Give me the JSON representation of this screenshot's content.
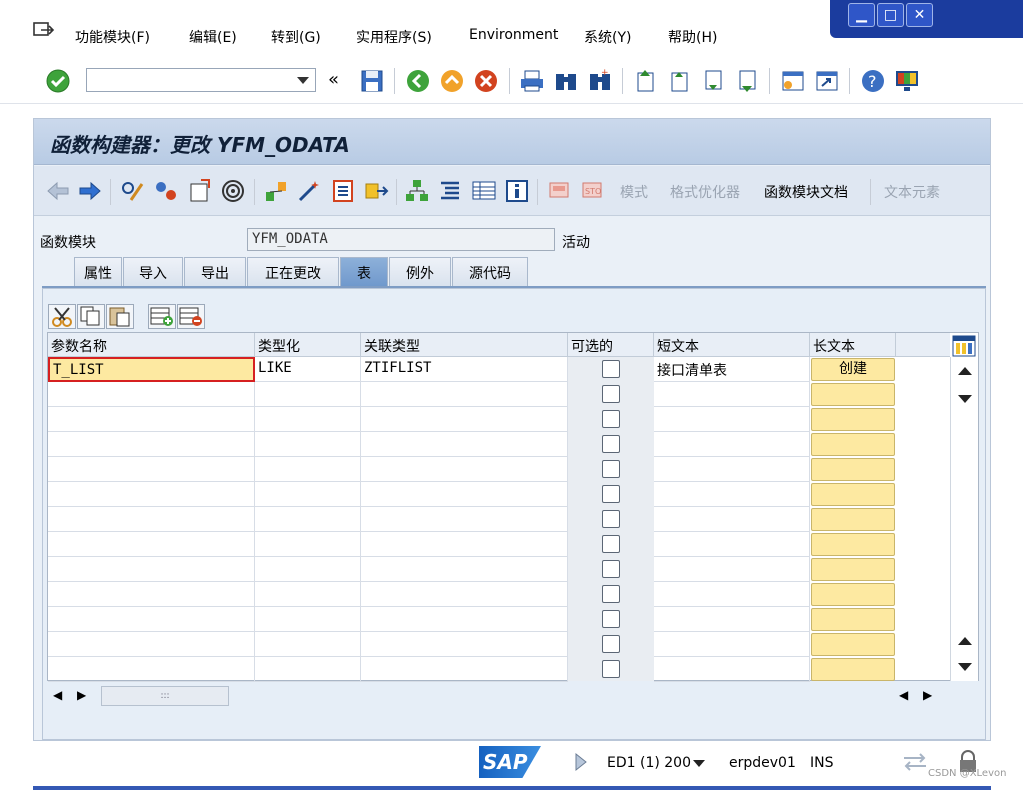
{
  "menubar": {
    "items": [
      "功能模块(F)",
      "编辑(E)",
      "转到(G)",
      "实用程序(S)",
      "Environment",
      "系统(Y)",
      "帮助(H)"
    ]
  },
  "window_controls": [
    "minimize",
    "maximize",
    "close"
  ],
  "std_toolbar": {
    "command_field": {
      "value": "",
      "placeholder": ""
    }
  },
  "title": "函数构建器：更改 YFM_ODATA",
  "app_toolbar": {
    "text_buttons": [
      {
        "label": "模式",
        "enabled": false
      },
      {
        "label": "格式优化器",
        "enabled": false
      },
      {
        "label": "函数模块文档",
        "enabled": true
      },
      {
        "label": "文本元素",
        "enabled": false
      }
    ]
  },
  "function_module": {
    "label": "函数模块",
    "value": "YFM_ODATA",
    "status": "活动"
  },
  "tabs": [
    {
      "label": "属性",
      "active": false
    },
    {
      "label": "导入",
      "active": false
    },
    {
      "label": "导出",
      "active": false
    },
    {
      "label": "正在更改",
      "active": false
    },
    {
      "label": "表",
      "active": true
    },
    {
      "label": "例外",
      "active": false
    },
    {
      "label": "源代码",
      "active": false
    }
  ],
  "grid": {
    "columns": [
      "参数名称",
      "类型化",
      "关联类型",
      "可选的",
      "短文本",
      "长文本"
    ],
    "rows": [
      {
        "param": "T_LIST",
        "typing": "LIKE",
        "assoc_type": "ZTIFLIST",
        "optional": false,
        "short_text": "接口清单表",
        "long_text": "创建"
      },
      {
        "param": "",
        "typing": "",
        "assoc_type": "",
        "optional": false,
        "short_text": "",
        "long_text": ""
      },
      {
        "param": "",
        "typing": "",
        "assoc_type": "",
        "optional": false,
        "short_text": "",
        "long_text": ""
      },
      {
        "param": "",
        "typing": "",
        "assoc_type": "",
        "optional": false,
        "short_text": "",
        "long_text": ""
      },
      {
        "param": "",
        "typing": "",
        "assoc_type": "",
        "optional": false,
        "short_text": "",
        "long_text": ""
      },
      {
        "param": "",
        "typing": "",
        "assoc_type": "",
        "optional": false,
        "short_text": "",
        "long_text": ""
      },
      {
        "param": "",
        "typing": "",
        "assoc_type": "",
        "optional": false,
        "short_text": "",
        "long_text": ""
      },
      {
        "param": "",
        "typing": "",
        "assoc_type": "",
        "optional": false,
        "short_text": "",
        "long_text": ""
      },
      {
        "param": "",
        "typing": "",
        "assoc_type": "",
        "optional": false,
        "short_text": "",
        "long_text": ""
      },
      {
        "param": "",
        "typing": "",
        "assoc_type": "",
        "optional": false,
        "short_text": "",
        "long_text": ""
      },
      {
        "param": "",
        "typing": "",
        "assoc_type": "",
        "optional": false,
        "short_text": "",
        "long_text": ""
      },
      {
        "param": "",
        "typing": "",
        "assoc_type": "",
        "optional": false,
        "short_text": "",
        "long_text": ""
      },
      {
        "param": "",
        "typing": "",
        "assoc_type": "",
        "optional": false,
        "short_text": "",
        "long_text": ""
      }
    ]
  },
  "statusbar": {
    "logo": "SAP",
    "system": "ED1 (1) 200",
    "server": "erpdev01",
    "mode": "INS",
    "watermark": "CSDN @XLevon"
  },
  "colors": {
    "title_bg": "#c3d4ea",
    "tab_active": "#7ea3d2",
    "button_yellow": "#fde9a1",
    "sap_blue": "#1561c0"
  }
}
